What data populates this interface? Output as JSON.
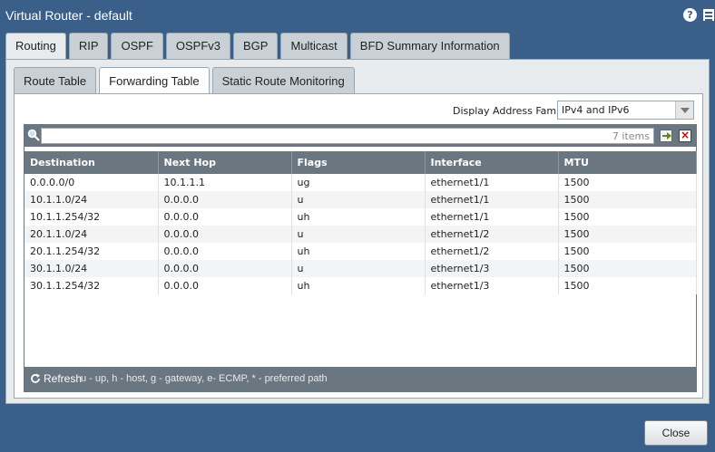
{
  "window": {
    "title": "Virtual Router - default"
  },
  "outer_tabs": [
    {
      "label": "Routing",
      "active": true
    },
    {
      "label": "RIP",
      "active": false
    },
    {
      "label": "OSPF",
      "active": false
    },
    {
      "label": "OSPFv3",
      "active": false
    },
    {
      "label": "BGP",
      "active": false
    },
    {
      "label": "Multicast",
      "active": false
    },
    {
      "label": "BFD Summary Information",
      "active": false
    }
  ],
  "inner_tabs": [
    {
      "label": "Route Table",
      "active": false
    },
    {
      "label": "Forwarding Table",
      "active": true
    },
    {
      "label": "Static Route Monitoring",
      "active": false
    }
  ],
  "filter": {
    "family_label": "Display Address Family",
    "family_value": "IPv4 and IPv6"
  },
  "search": {
    "count": "7 items"
  },
  "table": {
    "columns": [
      "Destination",
      "Next Hop",
      "Flags",
      "Interface",
      "MTU"
    ],
    "rows": [
      [
        "0.0.0.0/0",
        "10.1.1.1",
        "ug",
        "ethernet1/1",
        "1500"
      ],
      [
        "10.1.1.0/24",
        "0.0.0.0",
        "u",
        "ethernet1/1",
        "1500"
      ],
      [
        "10.1.1.254/32",
        "0.0.0.0",
        "uh",
        "ethernet1/1",
        "1500"
      ],
      [
        "20.1.1.0/24",
        "0.0.0.0",
        "u",
        "ethernet1/2",
        "1500"
      ],
      [
        "20.1.1.254/32",
        "0.0.0.0",
        "uh",
        "ethernet1/2",
        "1500"
      ],
      [
        "30.1.1.0/24",
        "0.0.0.0",
        "u",
        "ethernet1/3",
        "1500"
      ],
      [
        "30.1.1.254/32",
        "0.0.0.0",
        "uh",
        "ethernet1/3",
        "1500"
      ]
    ]
  },
  "footer": {
    "refresh_label": "Refresh",
    "legend": "u - up, h - host, g - gateway, e- ECMP, * - preferred path"
  },
  "close_label": "Close"
}
